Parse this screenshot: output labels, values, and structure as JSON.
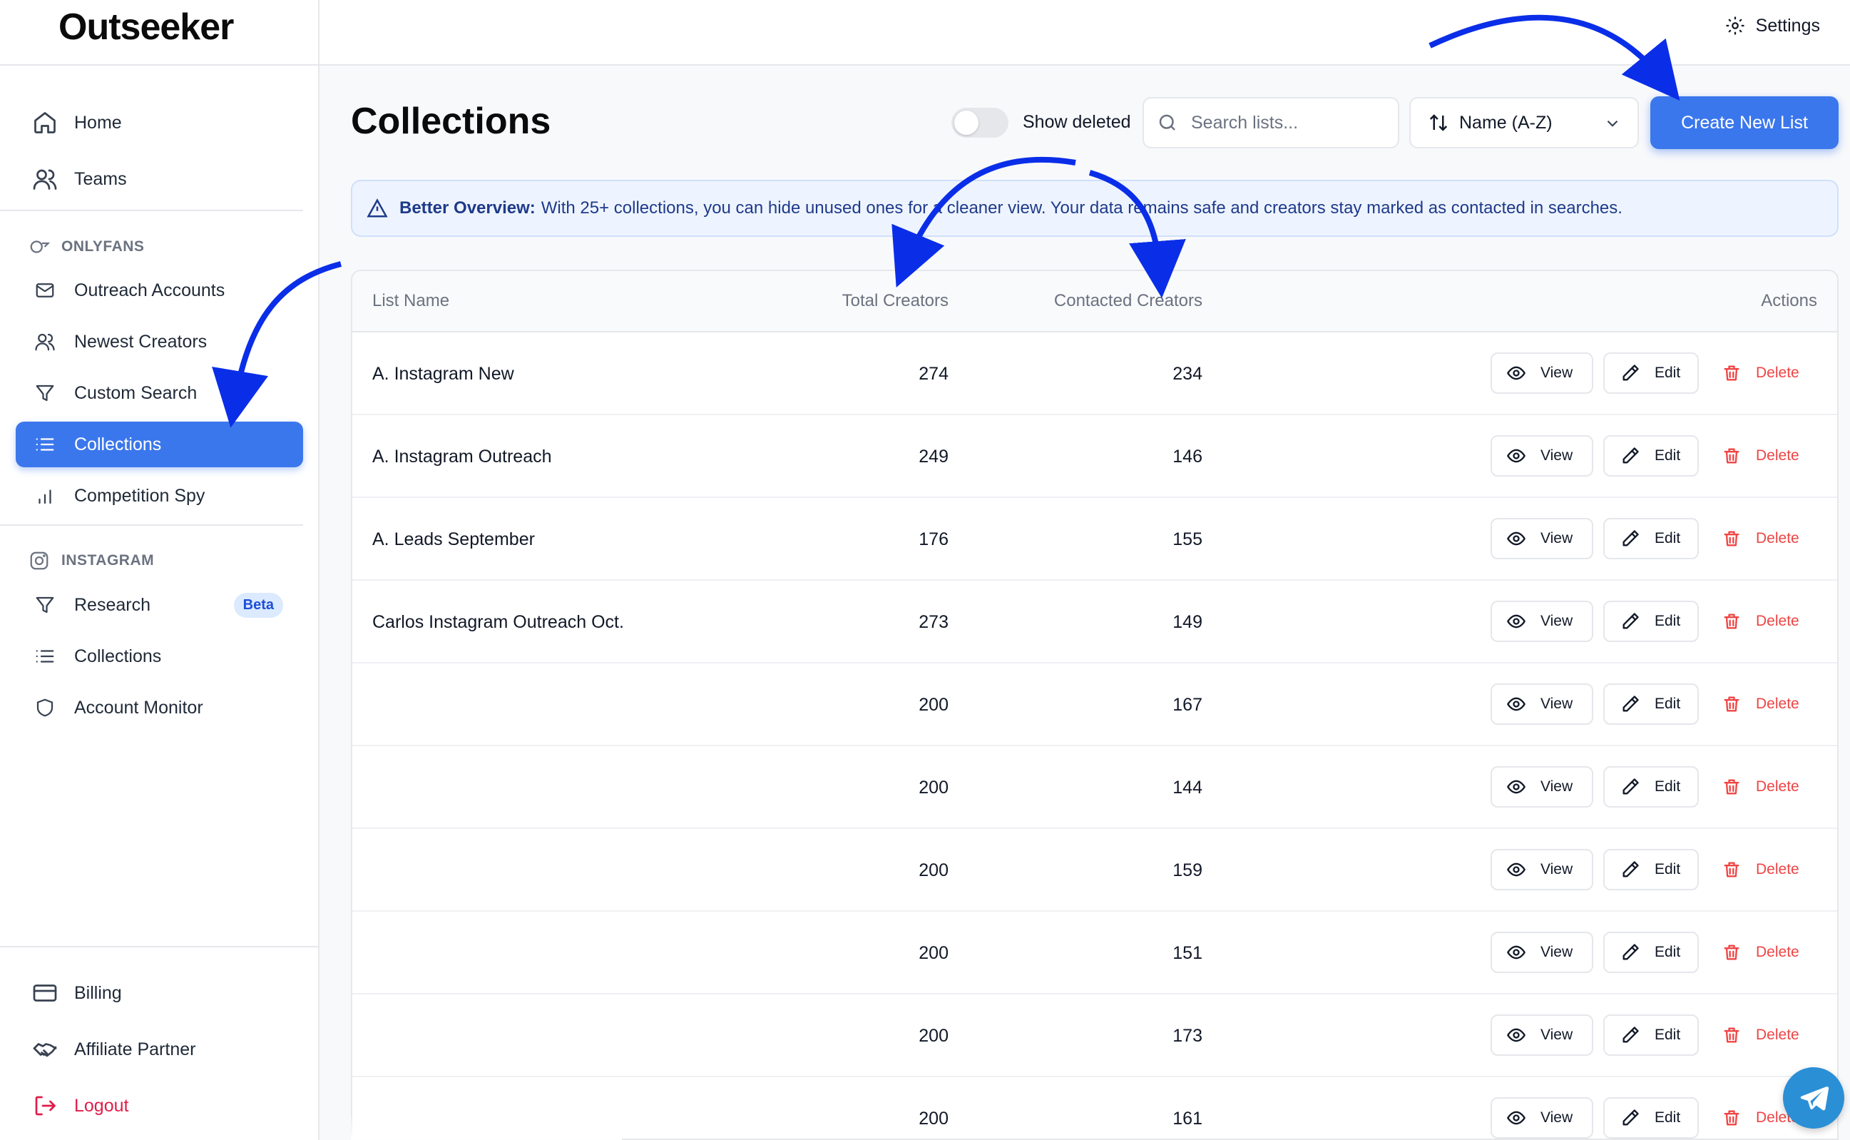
{
  "app": {
    "logo": "Outseeker",
    "settings_label": "Settings"
  },
  "sidebar": {
    "top_items": [
      {
        "label": "Home",
        "icon": "home-icon"
      },
      {
        "label": "Teams",
        "icon": "users-icon"
      }
    ],
    "onlyfans_section": "ONLYFANS",
    "onlyfans_items": [
      {
        "label": "Outreach Accounts",
        "icon": "mail-icon"
      },
      {
        "label": "Newest Creators",
        "icon": "users-icon"
      },
      {
        "label": "Custom Search",
        "icon": "filter-icon"
      },
      {
        "label": "Collections",
        "icon": "list-icon",
        "active": true
      },
      {
        "label": "Competition Spy",
        "icon": "bar-chart-icon"
      }
    ],
    "instagram_section": "INSTAGRAM",
    "instagram_items": [
      {
        "label": "Research",
        "icon": "filter-icon",
        "badge": "Beta"
      },
      {
        "label": "Collections",
        "icon": "list-icon"
      },
      {
        "label": "Account Monitor",
        "icon": "shield-icon"
      }
    ],
    "bottom_items": [
      {
        "label": "Billing",
        "icon": "credit-card-icon"
      },
      {
        "label": "Affiliate Partner",
        "icon": "handshake-icon"
      },
      {
        "label": "Logout",
        "icon": "logout-icon"
      }
    ]
  },
  "header": {
    "title": "Collections",
    "show_deleted_label": "Show deleted",
    "search_placeholder": "Search lists...",
    "sort_value": "Name (A-Z)",
    "create_label": "Create New List"
  },
  "alert": {
    "bold": "Better Overview:",
    "text": "With 25+ collections, you can hide unused ones for a cleaner view. Your data remains safe and creators stay marked as contacted in searches."
  },
  "table": {
    "columns": {
      "name": "List Name",
      "total": "Total Creators",
      "contacted": "Contacted Creators",
      "actions": "Actions"
    },
    "action_labels": {
      "view": "View",
      "edit": "Edit",
      "delete": "Delete"
    },
    "rows": [
      {
        "name": "A. Instagram New",
        "total": "274",
        "contacted": "234"
      },
      {
        "name": "A. Instagram Outreach",
        "total": "249",
        "contacted": "146"
      },
      {
        "name": "A. Leads September",
        "total": "176",
        "contacted": "155"
      },
      {
        "name": "Carlos Instagram Outreach Oct.",
        "total": "273",
        "contacted": "149"
      },
      {
        "name": "",
        "total": "200",
        "contacted": "167"
      },
      {
        "name": "",
        "total": "200",
        "contacted": "144"
      },
      {
        "name": "",
        "total": "200",
        "contacted": "159"
      },
      {
        "name": "",
        "total": "200",
        "contacted": "151"
      },
      {
        "name": "",
        "total": "200",
        "contacted": "173"
      },
      {
        "name": "",
        "total": "200",
        "contacted": "161"
      }
    ]
  },
  "colors": {
    "accent": "#3b77ec",
    "danger": "#ef4444",
    "annotation_arrow": "#0a2ee8"
  }
}
